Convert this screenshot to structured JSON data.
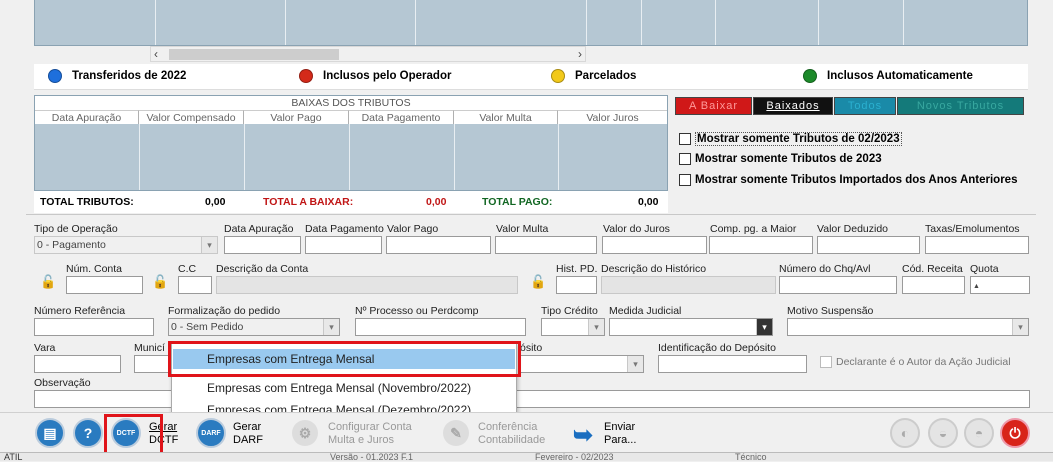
{
  "legend": {
    "items": [
      {
        "label": "Transferidos de 2022",
        "color": "#1e6fdc"
      },
      {
        "label": "Inclusos pelo Operador",
        "color": "#d42a1a"
      },
      {
        "label": "Parcelados",
        "color": "#f2c91a"
      },
      {
        "label": "Inclusos Automaticamente",
        "color": "#1c8a2a"
      }
    ]
  },
  "baixas": {
    "title": "BAIXAS DOS TRIBUTOS",
    "columns": [
      "Data Apuração",
      "Valor Compensado",
      "Valor Pago",
      "Data Pagamento",
      "Valor Multa",
      "Valor Juros"
    ]
  },
  "totals": {
    "tributos_label": "TOTAL TRIBUTOS:",
    "tributos_value": "0,00",
    "a_baixar_label": "TOTAL A BAIXAR:",
    "a_baixar_value": "0,00",
    "pago_label": "TOTAL PAGO:",
    "pago_value": "0,00"
  },
  "tabs": [
    "A Baixar",
    "Baixados",
    "Todos",
    "Novos Tributos"
  ],
  "filters": [
    "Mostrar somente Tributos de 02/2023",
    "Mostrar somente Tributos de 2023",
    "Mostrar somente Tributos Importados dos Anos Anteriores"
  ],
  "form": {
    "tipo_operacao_label": "Tipo de Operação",
    "tipo_operacao_value": "0 - Pagamento",
    "data_apuracao_label": "Data Apuração",
    "data_pagamento_label": "Data Pagamento",
    "valor_pago_label": "Valor Pago",
    "valor_multa_label": "Valor Multa",
    "valor_juros_label": "Valor do Juros",
    "comp_pg_label": "Comp. pg. a Maior",
    "valor_deduzido_label": "Valor Deduzido",
    "taxas_label": "Taxas/Emolumentos",
    "num_conta_label": "Núm. Conta",
    "cc_label": "C.C",
    "desc_conta_label": "Descrição da Conta",
    "hist_pd_label": "Hist. PD.",
    "desc_hist_label": "Descrição do Histórico",
    "num_chq_label": "Número do Chq/Avl",
    "cod_receita_label": "Cód. Receita",
    "quota_label": "Quota",
    "num_ref_label": "Número Referência",
    "formalizacao_label": "Formalização do pedido",
    "formalizacao_value": "0 - Sem Pedido",
    "processo_label": "Nº Processo ou Perdcomp",
    "tipo_credito_label": "Tipo Crédito",
    "medida_label": "Medida Judicial",
    "motivo_label": "Motivo Suspensão",
    "vara_label": "Vara",
    "municipio_label": "Municí",
    "deposito_label": "ósito",
    "ident_deposito_label": "Identificação do Depósito",
    "declarante_label": "Declarante é o Autor da Ação Judicial",
    "observacao_label": "Observação"
  },
  "popup": {
    "options": [
      "Empresas com Entrega Mensal",
      "Empresas com Entrega Mensal (Novembro/2022)",
      "Empresas com Entrega Mensal (Dezembro/2022)"
    ]
  },
  "toolbar": {
    "gerar_dctf_1": "Gerar",
    "gerar_dctf_2": "DCTF",
    "gerar_darf_1": "Gerar",
    "gerar_darf_2": "DARF",
    "config_1": "Configurar Conta",
    "config_2": "Multa  e  Juros",
    "conf_1": "Conferência",
    "conf_2": "Contabilidade",
    "enviar_1": "Enviar",
    "enviar_2": "Para...",
    "dctf_icon_text": "DCTF",
    "darf_icon_text": "DARF"
  },
  "statusbar": {
    "left": "ATIL",
    "mid1": "Versão - 01.2023 F.1",
    "mid2": "Fevereiro - 02/2023",
    "right": "Técnico"
  }
}
